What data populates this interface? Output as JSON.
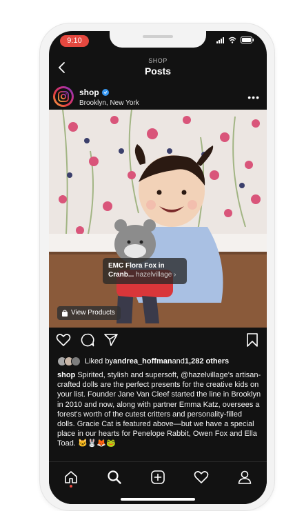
{
  "status_bar": {
    "time": "9:10"
  },
  "header": {
    "subtitle": "SHOP",
    "title": "Posts"
  },
  "post": {
    "account_name": "shop",
    "location": "Brooklyn, New York",
    "product_tag": {
      "name_line1": "EMC Flora Fox in",
      "name_line2": "Cranb...",
      "brand": "hazelvillage"
    },
    "view_products_label": "View Products",
    "likes": {
      "prefix": "Liked by ",
      "user": "andrea_hoffman",
      "middle": " and ",
      "count": "1,282 others"
    },
    "caption": {
      "author": "shop",
      "text": " Spirited, stylish and supersoft, @hazelvillage's artisan-crafted dolls are the perfect presents for the creative kids on your list. Founder Jane Van Cleef started the line in Brooklyn in 2010 and now, along with partner Emma Katz, oversees a forest's worth of the cutest critters and personality-filled dolls. Gracie Cat is featured above—but we have a special place in our hearts for Penelope Rabbit, Owen Fox and Ella Toad. 🐱🐰🦊🐸"
    }
  },
  "icons": {
    "back": "back-arrow-icon",
    "verified": "verified-badge-icon",
    "more": "more-options-icon",
    "bag": "shopping-bag-icon",
    "like": "heart-icon",
    "comment": "comment-icon",
    "share": "send-icon",
    "save": "bookmark-icon",
    "nav": [
      "home-icon",
      "search-icon",
      "add-post-icon",
      "activity-icon",
      "profile-icon"
    ]
  },
  "colors": {
    "background": "#121212",
    "accent_red": "#e5483f",
    "verified_blue": "#3897f0"
  }
}
